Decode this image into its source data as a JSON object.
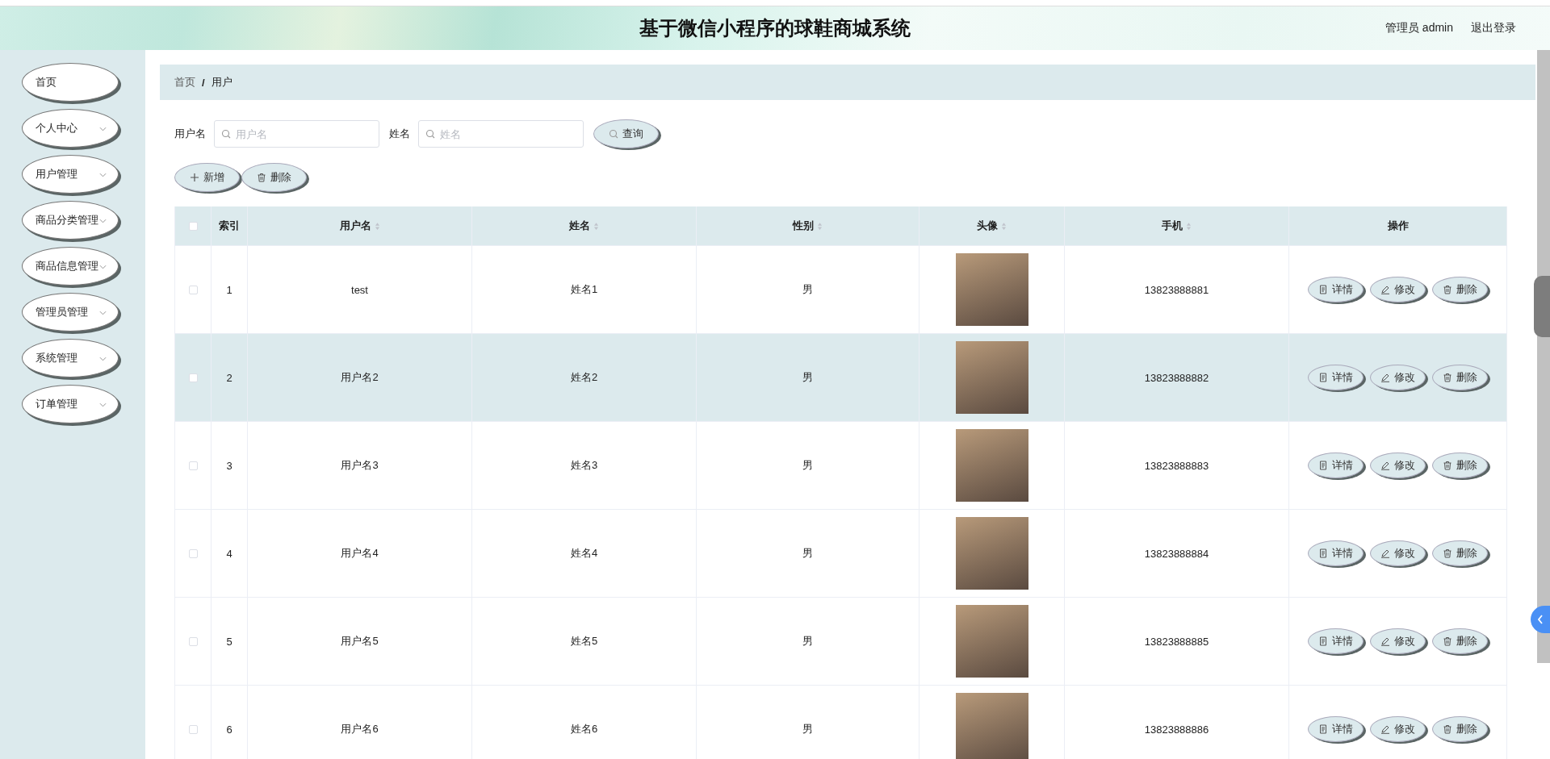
{
  "header": {
    "title": "基于微信小程序的球鞋商城系统",
    "user": "管理员 admin",
    "logout": "退出登录"
  },
  "sidebar": {
    "items": [
      {
        "label": "首页",
        "expandable": false
      },
      {
        "label": "个人中心",
        "expandable": true
      },
      {
        "label": "用户管理",
        "expandable": true
      },
      {
        "label": "商品分类管理",
        "expandable": true
      },
      {
        "label": "商品信息管理",
        "expandable": true
      },
      {
        "label": "管理员管理",
        "expandable": true
      },
      {
        "label": "系统管理",
        "expandable": true
      },
      {
        "label": "订单管理",
        "expandable": true
      }
    ]
  },
  "breadcrumb": {
    "separator": "/",
    "items": [
      "首页",
      "用户"
    ]
  },
  "search": {
    "fields": [
      {
        "label": "用户名",
        "placeholder": "用户名"
      },
      {
        "label": "姓名",
        "placeholder": "姓名"
      }
    ],
    "button": "查询"
  },
  "actions": [
    {
      "kind": "add",
      "label": "新增"
    },
    {
      "kind": "delete",
      "label": "删除"
    }
  ],
  "table": {
    "all_checked": false,
    "columns": [
      {
        "label": "索引",
        "sortable": false
      },
      {
        "label": "用户名",
        "sortable": true
      },
      {
        "label": "姓名",
        "sortable": true
      },
      {
        "label": "性别",
        "sortable": true
      },
      {
        "label": "头像",
        "sortable": true
      },
      {
        "label": "手机",
        "sortable": true
      },
      {
        "label": "操作",
        "sortable": false
      }
    ],
    "rows": [
      {
        "checked": false,
        "selected": false,
        "index": "1",
        "username": "test",
        "name": "姓名1",
        "gender": "男",
        "phone": "13823888881",
        "actions": [
          {
            "kind": "detail",
            "label": "详情"
          },
          {
            "kind": "edit",
            "label": "修改"
          },
          {
            "kind": "delete",
            "label": "删除"
          }
        ]
      },
      {
        "checked": false,
        "selected": true,
        "index": "2",
        "username": "用户名2",
        "name": "姓名2",
        "gender": "男",
        "phone": "13823888882",
        "actions": [
          {
            "kind": "detail",
            "label": "详情"
          },
          {
            "kind": "edit",
            "label": "修改"
          },
          {
            "kind": "delete",
            "label": "删除"
          }
        ]
      },
      {
        "checked": false,
        "selected": false,
        "index": "3",
        "username": "用户名3",
        "name": "姓名3",
        "gender": "男",
        "phone": "13823888883",
        "actions": [
          {
            "kind": "detail",
            "label": "详情"
          },
          {
            "kind": "edit",
            "label": "修改"
          },
          {
            "kind": "delete",
            "label": "删除"
          }
        ]
      },
      {
        "checked": false,
        "selected": false,
        "index": "4",
        "username": "用户名4",
        "name": "姓名4",
        "gender": "男",
        "phone": "13823888884",
        "actions": [
          {
            "kind": "detail",
            "label": "详情"
          },
          {
            "kind": "edit",
            "label": "修改"
          },
          {
            "kind": "delete",
            "label": "删除"
          }
        ]
      },
      {
        "checked": false,
        "selected": false,
        "index": "5",
        "username": "用户名5",
        "name": "姓名5",
        "gender": "男",
        "phone": "13823888885",
        "actions": [
          {
            "kind": "detail",
            "label": "详情"
          },
          {
            "kind": "edit",
            "label": "修改"
          },
          {
            "kind": "delete",
            "label": "删除"
          }
        ]
      },
      {
        "checked": false,
        "selected": false,
        "index": "6",
        "username": "用户名6",
        "name": "姓名6",
        "gender": "男",
        "phone": "13823888886",
        "actions": [
          {
            "kind": "detail",
            "label": "详情"
          },
          {
            "kind": "edit",
            "label": "修改"
          },
          {
            "kind": "delete",
            "label": "删除"
          }
        ]
      }
    ]
  }
}
